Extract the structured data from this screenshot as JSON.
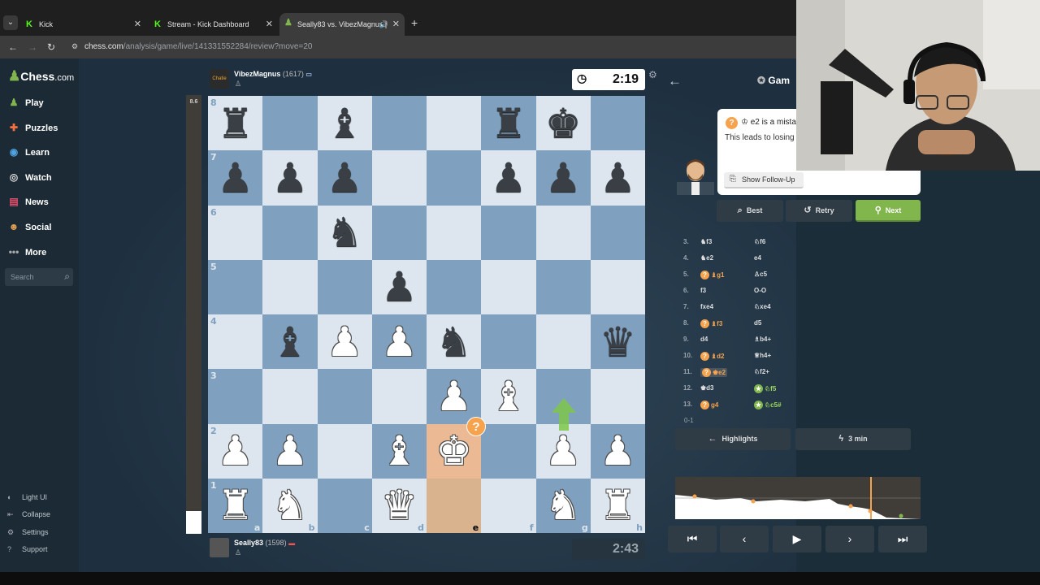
{
  "browser": {
    "tabs": [
      {
        "title": "Kick",
        "favicon": "K"
      },
      {
        "title": "Stream - Kick Dashboard",
        "favicon": "K"
      },
      {
        "title": "Seally83 vs. VibezMagnus |",
        "favicon": "♟",
        "active": true
      }
    ],
    "url_host": "chess.com",
    "url_path": "/analysis/game/live/141331552284/review?move=20"
  },
  "sidebar": {
    "logo_text": "Chess",
    "logo_suffix": ".com",
    "items": [
      {
        "label": "Play",
        "icon": "play-icon"
      },
      {
        "label": "Puzzles",
        "icon": "puzzles-icon"
      },
      {
        "label": "Learn",
        "icon": "learn-icon"
      },
      {
        "label": "Watch",
        "icon": "watch-icon"
      },
      {
        "label": "News",
        "icon": "news-icon"
      },
      {
        "label": "Social",
        "icon": "social-icon"
      },
      {
        "label": "More",
        "icon": "more-icon"
      }
    ],
    "search_placeholder": "Search",
    "footer": [
      {
        "label": "Light UI"
      },
      {
        "label": "Collapse"
      },
      {
        "label": "Settings"
      },
      {
        "label": "Support"
      }
    ]
  },
  "board": {
    "eval": "8.6",
    "top_player": {
      "name": "VibezMagnus",
      "rating": "(1617)",
      "clock": "2:19",
      "avatar": "Chatie"
    },
    "bottom_player": {
      "name": "Seally83",
      "rating": "(1598)",
      "clock": "2:43"
    },
    "ranks": [
      "8",
      "7",
      "6",
      "5",
      "4",
      "3",
      "2",
      "1"
    ],
    "files": [
      "a",
      "b",
      "c",
      "d",
      "e",
      "f",
      "g",
      "h"
    ],
    "position": [
      [
        "br",
        "",
        "bb",
        "",
        "",
        "br",
        "bk",
        ""
      ],
      [
        "bp",
        "bp",
        "bp",
        "",
        "",
        "bp",
        "bp",
        "bp"
      ],
      [
        "",
        "",
        "bn",
        "",
        "",
        "",
        "",
        ""
      ],
      [
        "",
        "",
        "",
        "bp",
        "",
        "",
        "",
        ""
      ],
      [
        "",
        "bb",
        "wp",
        "wp",
        "bn",
        "",
        "",
        "bq"
      ],
      [
        "",
        "",
        "",
        "",
        "wp",
        "wb",
        "",
        ""
      ],
      [
        "wp",
        "wp",
        "",
        "wb",
        "wk",
        "",
        "wp",
        "wp"
      ],
      [
        "wr",
        "wn",
        "",
        "wq",
        "",
        "",
        "wn",
        "wr"
      ]
    ],
    "mistake_mark": "?"
  },
  "review": {
    "game_tab_label": "Gam",
    "bubble": {
      "move_text": "e2 is a mista",
      "description": "This leads to losing",
      "follow_up_label": "Show Follow-Up"
    },
    "buttons": {
      "best": "Best",
      "retry": "Retry",
      "next": "Next"
    },
    "moves": [
      {
        "n": "3.",
        "w": "f3",
        "b": "f6",
        "wp": "♞",
        "bp": "♘"
      },
      {
        "n": "4.",
        "w": "e2",
        "b": "e4",
        "wp": "♞",
        "bp": ""
      },
      {
        "n": "5.",
        "w": "g1",
        "b": "c5",
        "wp": "♝",
        "bp": "♙",
        "wflag": "?"
      },
      {
        "n": "6.",
        "w": "f3",
        "b": "O-O",
        "wp": "",
        "bp": ""
      },
      {
        "n": "7.",
        "w": "fxe4",
        "b": "xe4",
        "wp": "",
        "bp": "♘"
      },
      {
        "n": "8.",
        "w": "f3",
        "b": "d5",
        "wp": "♝",
        "bp": "",
        "wflag": "?"
      },
      {
        "n": "9.",
        "w": "d4",
        "b": "b4+",
        "wp": "",
        "bp": "♗"
      },
      {
        "n": "10.",
        "w": "d2",
        "b": "h4+",
        "wp": "♝",
        "bp": "♕",
        "wflag": "?"
      },
      {
        "n": "11.",
        "w": "e2",
        "b": "f2+",
        "wp": "♚",
        "bp": "♘",
        "wflag": "?",
        "selected": true
      },
      {
        "n": "12.",
        "w": "d3",
        "b": "f5",
        "wp": "♚",
        "bp": "♘",
        "bflag": "g"
      },
      {
        "n": "13.",
        "w": "g4",
        "b": "c5#",
        "wp": "",
        "bp": "♘",
        "wflag": "?",
        "bflag": "g"
      }
    ],
    "result": "0-1",
    "highlights_label": "Highlights",
    "time_label": "3 min"
  },
  "colors": {
    "light_square": "#dde6ee",
    "dark_square": "#7fa1bf",
    "mistake": "#f7a24c",
    "next_green": "#81b64c"
  }
}
